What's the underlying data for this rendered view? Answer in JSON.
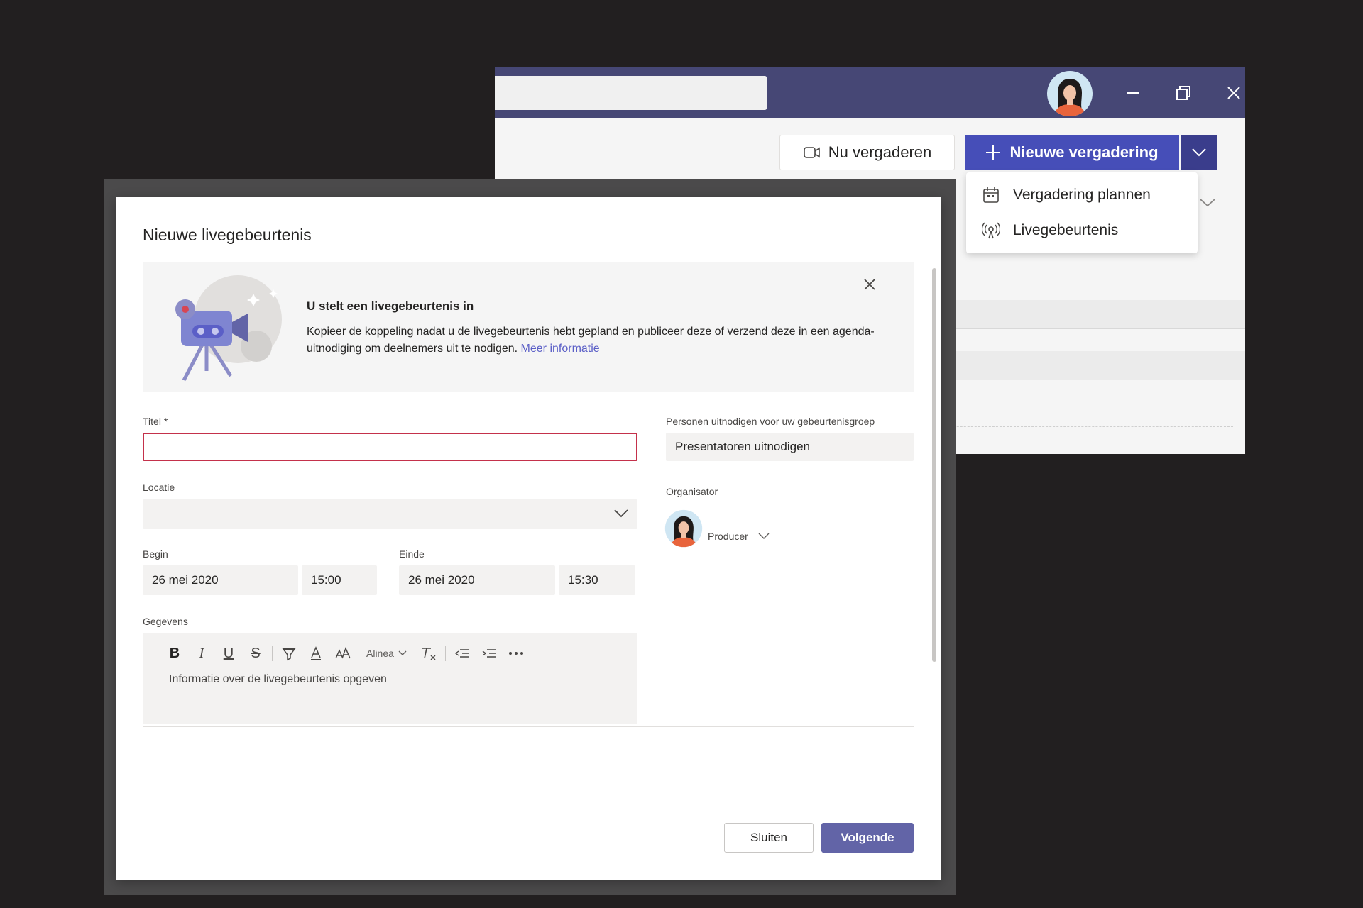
{
  "background_window": {
    "buttons": {
      "meet_now": "Nu vergaderen",
      "new_meeting": "Nieuwe vergadering"
    },
    "dropdown": {
      "items": [
        {
          "label": "Vergadering plannen",
          "icon": "calendar-icon"
        },
        {
          "label": "Livegebeurtenis",
          "icon": "broadcast-icon"
        }
      ]
    }
  },
  "dialog": {
    "title": "Nieuwe livegebeurtenis",
    "banner": {
      "heading": "U stelt een livegebeurtenis in",
      "text": "Kopieer de koppeling nadat u de livegebeurtenis hebt gepland en publiceer deze of verzend deze in een agenda-uitnodiging om deelnemers uit te nodigen.",
      "link": "Meer informatie"
    },
    "fields": {
      "title_label": "Titel *",
      "title_value": "",
      "location_label": "Locatie",
      "location_value": "",
      "start_label": "Begin",
      "start_date": "26 mei 2020",
      "start_time": "15:00",
      "end_label": "Einde",
      "end_date": "26 mei 2020",
      "end_time": "15:30",
      "details_label": "Gegevens",
      "details_placeholder": "Informatie over de livegebeurtenis opgeven",
      "invite_label": "Personen uitnodigen voor uw gebeurtenisgroep",
      "invite_placeholder": "Presentatoren uitnodigen",
      "organizer_label": "Organisator",
      "organizer_role": "Producer"
    },
    "toolbar": {
      "paragraph": "Alinea"
    },
    "actions": {
      "close": "Sluiten",
      "next": "Volgende"
    }
  },
  "colors": {
    "titlebar": "#464775",
    "accent": "#464eb8",
    "primary_button": "#6264a7",
    "error_border": "#c4314b",
    "link": "#5b5fc7"
  }
}
